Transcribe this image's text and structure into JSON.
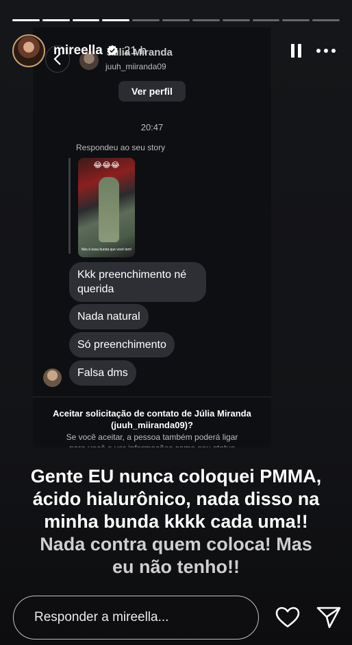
{
  "story": {
    "progress_total": 11,
    "progress_done": 4,
    "username": "mireella",
    "time_ago": "21 h"
  },
  "dm_screenshot": {
    "contact_name": "Júlia Miranda",
    "contact_handle": "juuh_miiranda09",
    "view_profile_label": "Ver perfil",
    "timestamp": "20:47",
    "replied_label": "Respondeu ao seu story",
    "story_thumb_emoji": "😂😂😂",
    "story_thumb_text": "Nós é essa bunda que você tem!",
    "messages": [
      "Kkk preenchimento né querida",
      "Nada natural",
      "Só preenchimento",
      "Falsa dms"
    ],
    "accept_title": "Aceitar solicitação de contato de Júlia Miranda (juuh_miiranda09)?",
    "accept_sub": "Se você aceitar, a pessoa também poderá ligar",
    "accept_sub2": "para você e ver informações como seu status"
  },
  "caption": {
    "line1": "Gente EU nunca coloquei PMMA,",
    "line2": "ácido hialurônico, nada disso na",
    "line3": "minha bunda kkkk cada uma!!",
    "line4": "Nada contra quem coloca! Mas",
    "line5": "eu não tenho!!"
  },
  "reply": {
    "placeholder": "Responder a mireella..."
  },
  "icons": {
    "verified": "verified-badge-icon",
    "pause": "pause-icon",
    "more": "more-icon",
    "back": "chevron-left-icon",
    "heart": "heart-icon",
    "send": "send-icon"
  }
}
